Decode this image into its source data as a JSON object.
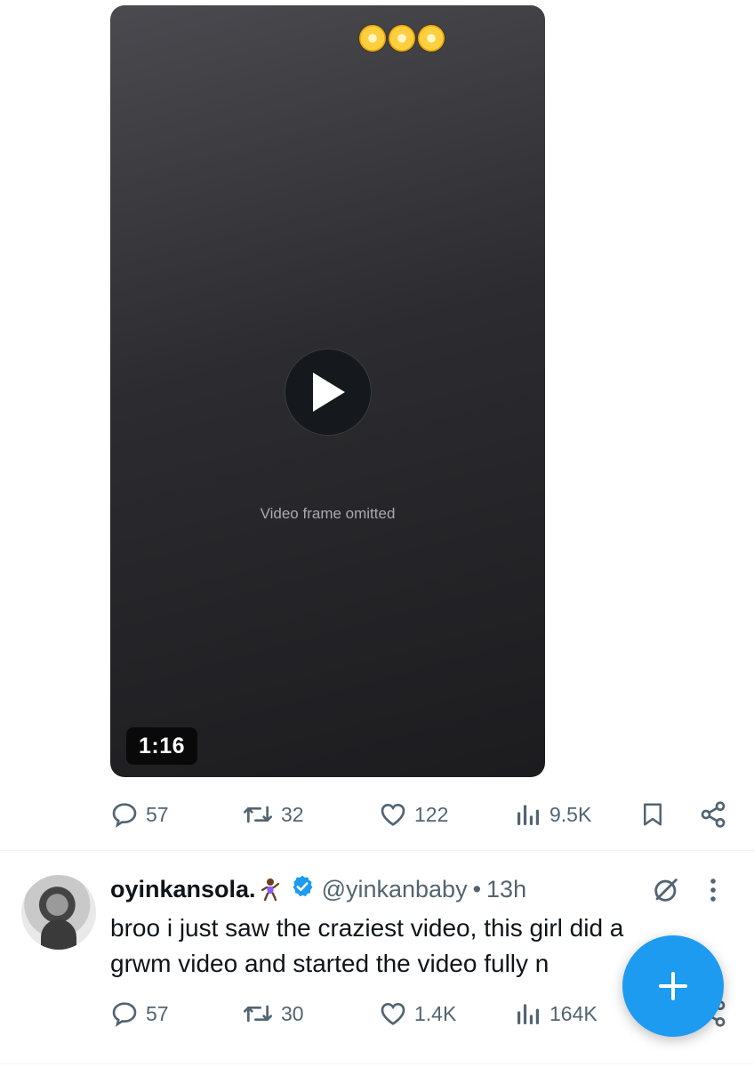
{
  "media": {
    "duration": "1:16",
    "placeholder_note": "Video frame omitted"
  },
  "tweet1_actions": {
    "replies": "57",
    "reposts": "32",
    "likes": "122",
    "views": "9.5K"
  },
  "tweet2": {
    "display_name": "oyinkansola.",
    "handle": "@yinkanbaby",
    "separator": "•",
    "time": "13h",
    "text_lines": [
      "broo i just saw the craziest video, this girl did a",
      "grwm video and started the video fully n"
    ],
    "actions": {
      "replies": "57",
      "reposts": "30",
      "likes": "1.4K",
      "views": "164K"
    }
  },
  "colors": {
    "accent": "#1d9bf0",
    "secondary_text": "#536471",
    "primary_text": "#0f1419"
  },
  "icons": [
    "reply-icon",
    "repost-icon",
    "like-icon",
    "views-icon",
    "bookmark-icon",
    "share-icon",
    "verified-badge-icon",
    "grok-icon",
    "more-icon",
    "compose-plus-icon",
    "play-icon"
  ]
}
